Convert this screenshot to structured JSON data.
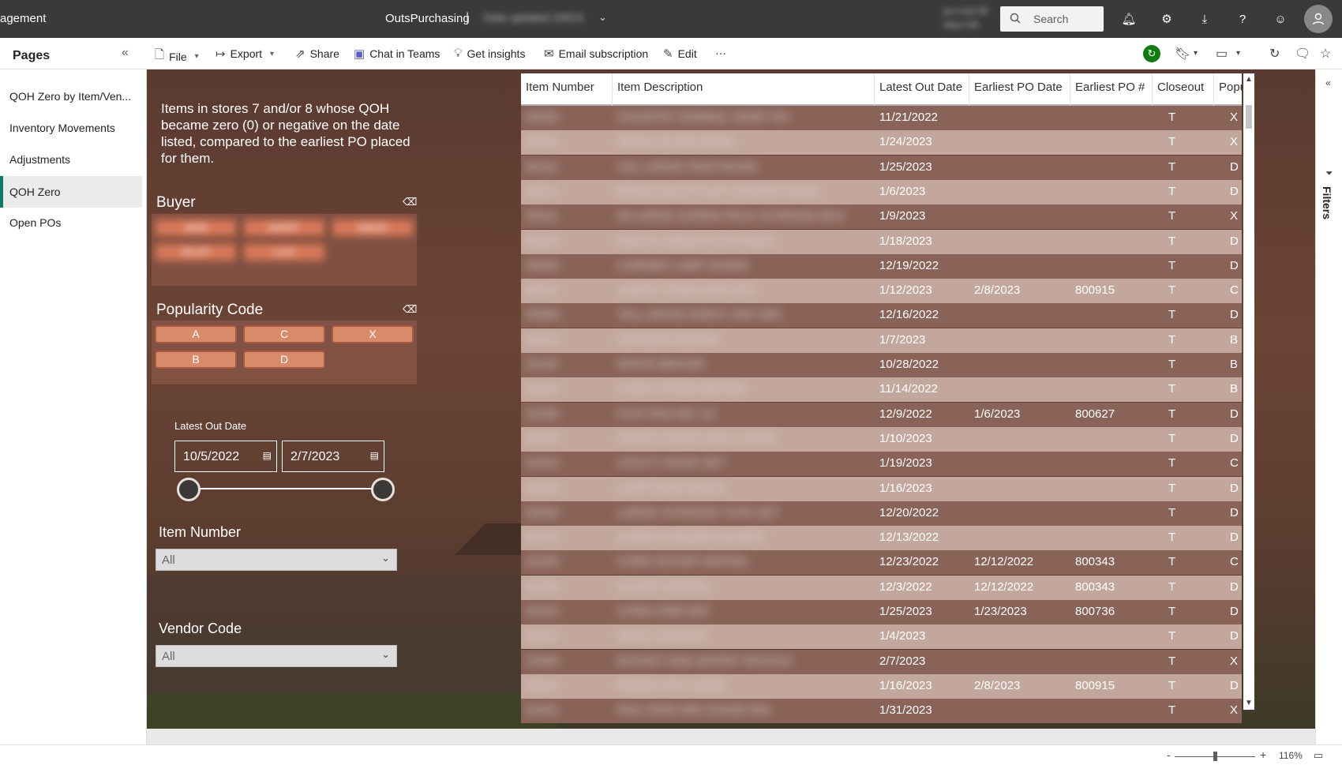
{
  "topbar": {
    "app_title": "agement",
    "report_title": "OutsPurchasing",
    "separator": "|",
    "data_updated": "Data updated 2/8/23",
    "trial": "pro trial 59 days left",
    "search_placeholder": "Search",
    "icons": [
      "bell-icon",
      "gear-icon",
      "download-icon",
      "help-icon",
      "smiley-icon",
      "avatar-icon"
    ]
  },
  "cmdbar": {
    "file": "File",
    "export": "Export",
    "share": "Share",
    "chat_in_teams": "Chat in Teams",
    "get_insights": "Get insights",
    "email_subscription": "Email subscription",
    "edit": "Edit",
    "more": "···"
  },
  "pages": {
    "title": "Pages",
    "items": [
      {
        "label": "QOH Zero by Item/Ven..."
      },
      {
        "label": "Inventory Movements"
      },
      {
        "label": "Adjustments"
      },
      {
        "label": "QOH Zero",
        "active": true
      },
      {
        "label": "Open POs"
      }
    ]
  },
  "report": {
    "description": "Items in stores 7 and/or 8 whose QOH became zero (0) or negative on the date listed, compared to the earliest PO placed for them.",
    "buyer": {
      "title": "Buyer",
      "chips": [
        "AMS",
        "MART",
        "SMJO",
        "RLVP",
        "LAS"
      ]
    },
    "popularity": {
      "title": "Popularity Code",
      "chips": [
        "A",
        "C",
        "X",
        "B",
        "D"
      ]
    },
    "date_slicer": {
      "label": "Latest Out Date",
      "start": "10/5/2022",
      "end": "2/7/2023"
    },
    "item_number": {
      "label": "Item Number",
      "value": "All"
    },
    "vendor_code": {
      "label": "Vendor Code",
      "value": "All"
    }
  },
  "table": {
    "columns": [
      "Item Number",
      "Item Description",
      "Latest Out Date",
      "Earliest PO Date",
      "Earliest PO #",
      "Closeout",
      "Popularity Code"
    ],
    "rows": [
      [
        "00020",
        "COUNTRY NORMAL HARD TIN",
        "11/21/2022",
        "",
        "",
        "T",
        "X"
      ],
      [
        "00041",
        "SMALL BLACK BOWL",
        "1/24/2023",
        "",
        "",
        "T",
        "X"
      ],
      [
        "00112",
        "CAL LARGE HIGH ROOM",
        "1/25/2023",
        "",
        "",
        "T",
        "D"
      ],
      [
        "00217",
        "BRASS MULTI FLAT HANGER HOOK",
        "1/6/2023",
        "",
        "",
        "T",
        "D"
      ],
      [
        "00311",
        "#8 LARGE SCREW PACK STORAGE BOX",
        "1/9/2023",
        "",
        "",
        "T",
        "X"
      ],
      [
        "00344",
        "WHITE LARGE PLATE RACK",
        "1/18/2023",
        "",
        "",
        "T",
        "D"
      ],
      [
        "00350",
        "CORNER LAMP SHADE",
        "12/19/2022",
        "",
        "",
        "T",
        "D"
      ],
      [
        "00417",
        "LARGE TOWEL BAR SET",
        "1/12/2023",
        "2/8/2023",
        "800915",
        "T",
        "C"
      ],
      [
        "00508",
        "TALL WOOD SHELF UNIT BIN",
        "12/16/2022",
        "",
        "",
        "T",
        "D"
      ],
      [
        "00612",
        "ANTIQUE BROOM",
        "1/7/2023",
        "",
        "",
        "T",
        "B"
      ],
      [
        "01140",
        "WHITE BROOM",
        "10/28/2022",
        "",
        "",
        "T",
        "B"
      ],
      [
        "01215",
        "CORN STRAW BROOM",
        "11/14/2022",
        "",
        "",
        "T",
        "B"
      ],
      [
        "01305",
        "FLAT PAN SET 10",
        "12/9/2022",
        "1/6/2023",
        "800627",
        "T",
        "D"
      ],
      [
        "01420",
        "FENCE STAPLE BOX LARGE",
        "1/10/2023",
        "",
        "",
        "T",
        "D"
      ],
      [
        "01510",
        "UTILITY HOOK SET",
        "1/19/2023",
        "",
        "",
        "T",
        "C"
      ],
      [
        "01633",
        "LAMP BASE WHITE",
        "1/16/2023",
        "",
        "",
        "T",
        "D"
      ],
      [
        "02040",
        "LARGE STORAGE TOTE SET",
        "12/20/2022",
        "",
        "",
        "T",
        "D"
      ],
      [
        "02101",
        "LARGE HANGING BASKET",
        "12/13/2022",
        "",
        "",
        "T",
        "D"
      ],
      [
        "02150",
        "CORN SCOOP SHOVEL",
        "12/23/2022",
        "12/12/2022",
        "800343",
        "T",
        "C"
      ],
      [
        "02160",
        "SCOOP SHOVEL",
        "12/3/2022",
        "12/12/2022",
        "800343",
        "T",
        "D"
      ],
      [
        "02210",
        "CORN CRIB NET",
        "1/25/2023",
        "1/23/2023",
        "800736",
        "T",
        "D"
      ],
      [
        "02241",
        "SMALL BUCKET",
        "1/4/2023",
        "",
        "",
        "T",
        "D"
      ],
      [
        "02300",
        "BUCKET AND WATER TROUGH",
        "2/7/2023",
        "",
        "",
        "T",
        "X"
      ],
      [
        "02311",
        "RIDGE CAP LARGE",
        "1/16/2023",
        "2/8/2023",
        "800915",
        "T",
        "D"
      ],
      [
        "02341",
        "RAIL FEED MID SHADE BIN",
        "1/31/2023",
        "",
        "",
        "T",
        "X"
      ]
    ]
  },
  "filters_label": "Filters",
  "statusbar": {
    "zoom": "116%",
    "minus": "-",
    "plus": "+"
  }
}
